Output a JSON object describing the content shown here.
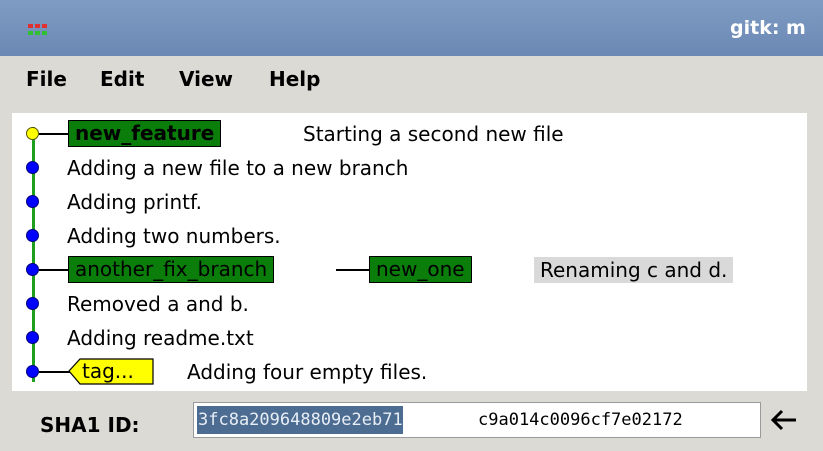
{
  "window": {
    "title": "gitk: m"
  },
  "menu": [
    {
      "label": "File"
    },
    {
      "label": "Edit"
    },
    {
      "label": "View"
    },
    {
      "label": "Help"
    }
  ],
  "commits": [
    {
      "message": "Starting a second new file",
      "branches": [
        "new_feature"
      ],
      "head": true
    },
    {
      "message": "Adding a new file to a new branch"
    },
    {
      "message": "Adding printf."
    },
    {
      "message": "Adding two numbers."
    },
    {
      "message": "Renaming c and d.",
      "branches": [
        "another_fix_branch",
        "new_one"
      ],
      "highlighted": true
    },
    {
      "message": "Removed a and b."
    },
    {
      "message": "Adding readme.txt"
    },
    {
      "message": "Adding four empty files.",
      "tags": [
        "tag..."
      ]
    }
  ],
  "sha": {
    "label": "SHA1 ID:",
    "value_selected": "3fc8a209648809e2eb71",
    "value_rest": "c9a014c0096cf7e02172"
  },
  "colors": {
    "branch_bg": "#0a7d0a",
    "graph_line": "#1e9f1e",
    "node": "#0000ff",
    "head_node": "#ffff00",
    "tag_bg": "#ffff00",
    "selection_bg": "#4d6c91",
    "titlebar": "#6a88b3"
  },
  "icons": {
    "app": "gitk-app-icon",
    "back": "left-arrow-icon"
  }
}
